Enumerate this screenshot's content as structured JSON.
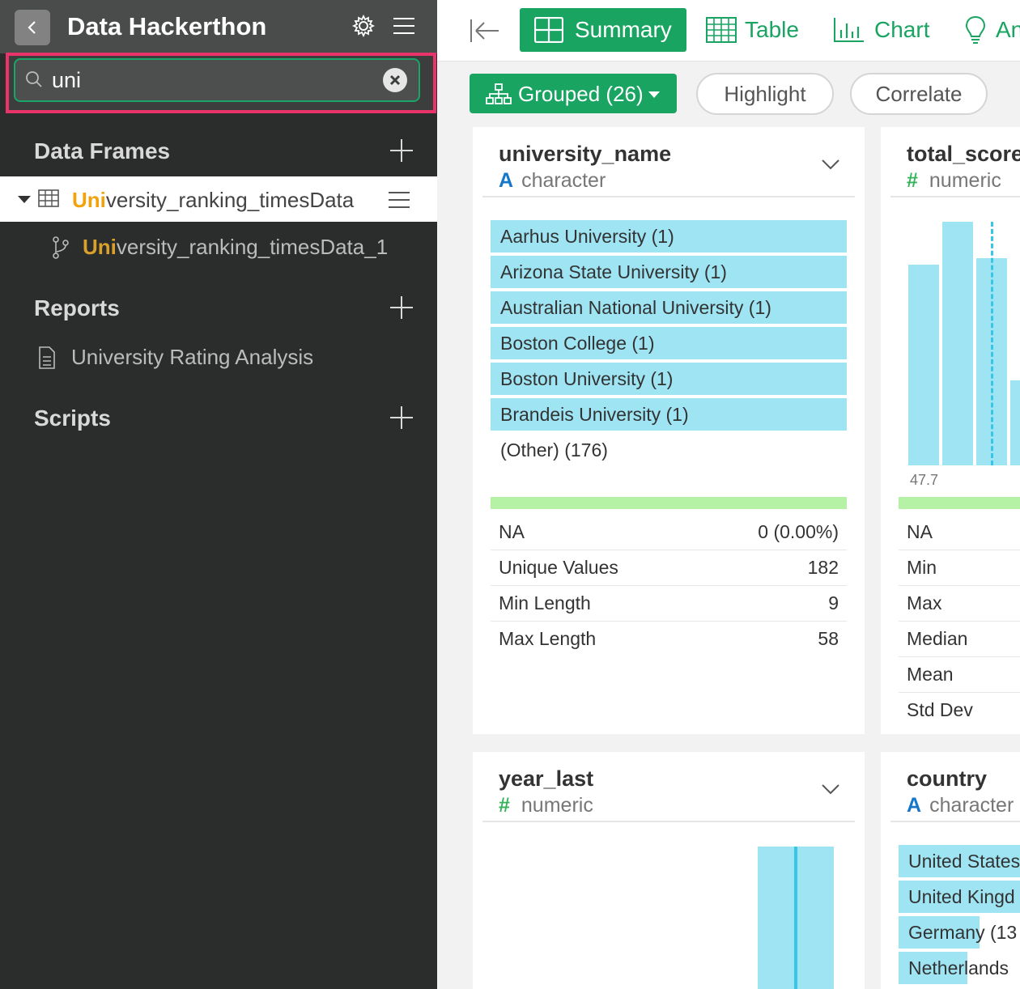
{
  "sidebar": {
    "title": "Data Hackerthon",
    "search": {
      "value": "uni"
    },
    "sections": {
      "data_frames": "Data Frames",
      "reports": "Reports",
      "scripts": "Scripts"
    },
    "data_frame": {
      "match": "Uni",
      "rest": "versity_ranking_timesData"
    },
    "branch": {
      "match": "Uni",
      "rest": "versity_ranking_timesData_1"
    },
    "report": {
      "match": "Uni",
      "rest": "versity Rating Analysis"
    }
  },
  "toolbar": {
    "tabs": [
      "Summary",
      "Table",
      "Chart",
      "An"
    ]
  },
  "subbar": {
    "grouped": "Grouped (26)",
    "highlight": "Highlight",
    "correlate": "Correlate"
  },
  "cards": {
    "university_name": {
      "name": "university_name",
      "type_symbol": "A",
      "type": "character",
      "values": [
        "Aarhus University (1)",
        "Arizona State University (1)",
        "Australian National University (1)",
        "Boston College (1)",
        "Boston University (1)",
        "Brandeis University (1)",
        "(Other) (176)"
      ],
      "stats": [
        {
          "k": "NA",
          "v": "0 (0.00%)"
        },
        {
          "k": "Unique Values",
          "v": "182"
        },
        {
          "k": "Min Length",
          "v": "9"
        },
        {
          "k": "Max Length",
          "v": "58"
        }
      ]
    },
    "total_score": {
      "name": "total_score",
      "type_symbol": "#",
      "type": "numeric",
      "axis_min": "47.7",
      "stats": [
        "NA",
        "Min",
        "Max",
        "Median",
        "Mean",
        "Std Dev"
      ]
    },
    "year_last": {
      "name": "year_last",
      "type_symbol": "#",
      "type": "numeric"
    },
    "country": {
      "name": "country",
      "type_symbol": "A",
      "type": "character",
      "values": [
        "United States",
        "United Kingd",
        "Germany (13",
        "Netherlands"
      ]
    }
  }
}
